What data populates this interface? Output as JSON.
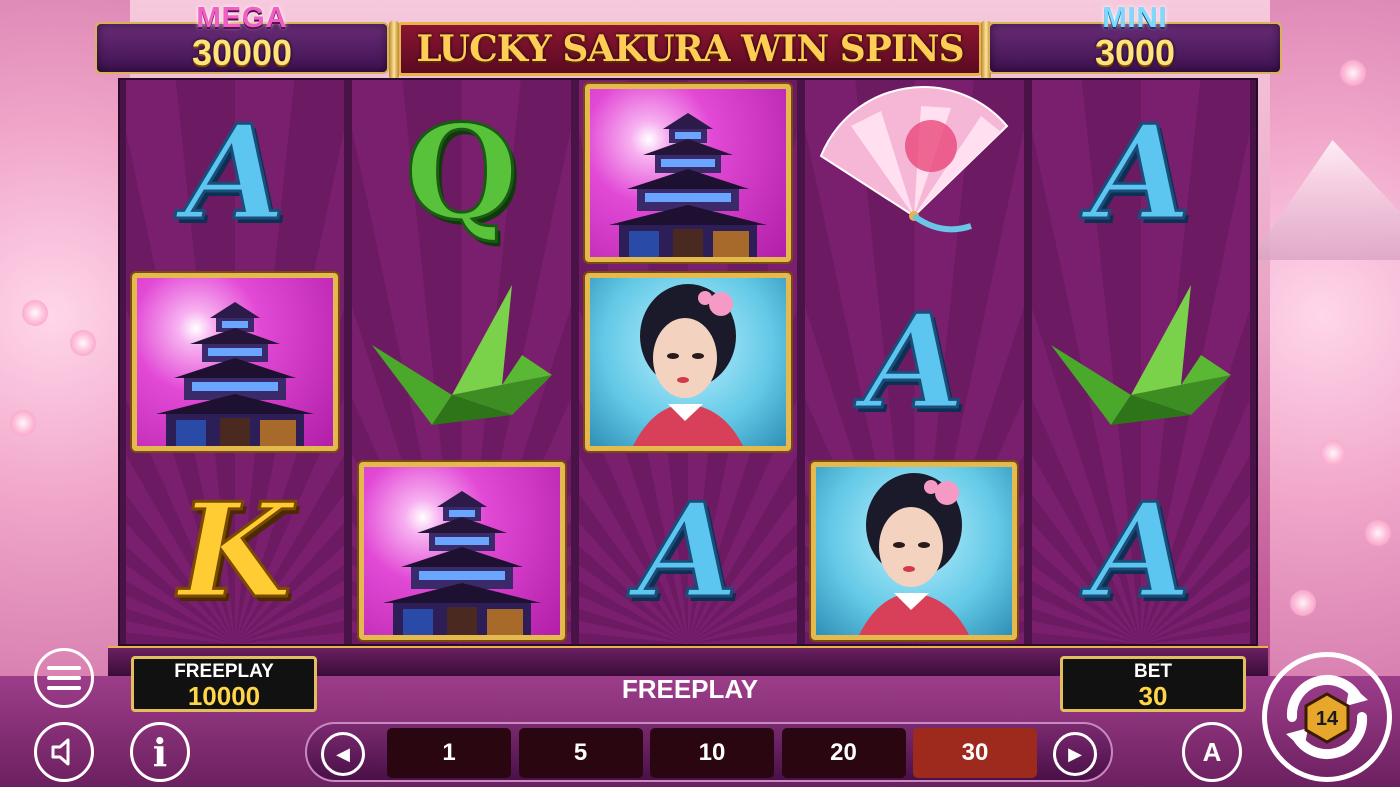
{
  "game": {
    "title": "LUCKY SAKURA WIN SPINS"
  },
  "jackpots": {
    "mega": {
      "label": "MEGA",
      "value": "30000"
    },
    "mini": {
      "label": "MINI",
      "value": "3000"
    }
  },
  "reels": [
    [
      "A",
      "pagoda",
      "K"
    ],
    [
      "Q",
      "crane",
      "pagoda"
    ],
    [
      "pagoda",
      "geisha",
      "A"
    ],
    [
      "fan",
      "A",
      "geisha"
    ],
    [
      "A",
      "crane",
      "A"
    ]
  ],
  "freeplay_box": {
    "label": "FREEPLAY",
    "value": "10000"
  },
  "bet_box": {
    "label": "BET",
    "value": "30"
  },
  "mode_label": "FREEPLAY",
  "bet_options": [
    "1",
    "5",
    "10",
    "20",
    "30"
  ],
  "selected_bet": "30",
  "buttons": {
    "info_glyph": "i",
    "auto_glyph": "A",
    "spin_badge": "14"
  },
  "colors": {
    "accent_gold": "#e6b44a",
    "reel_bg": "#7a1f6e",
    "selected_bet": "#9e2a1e"
  }
}
